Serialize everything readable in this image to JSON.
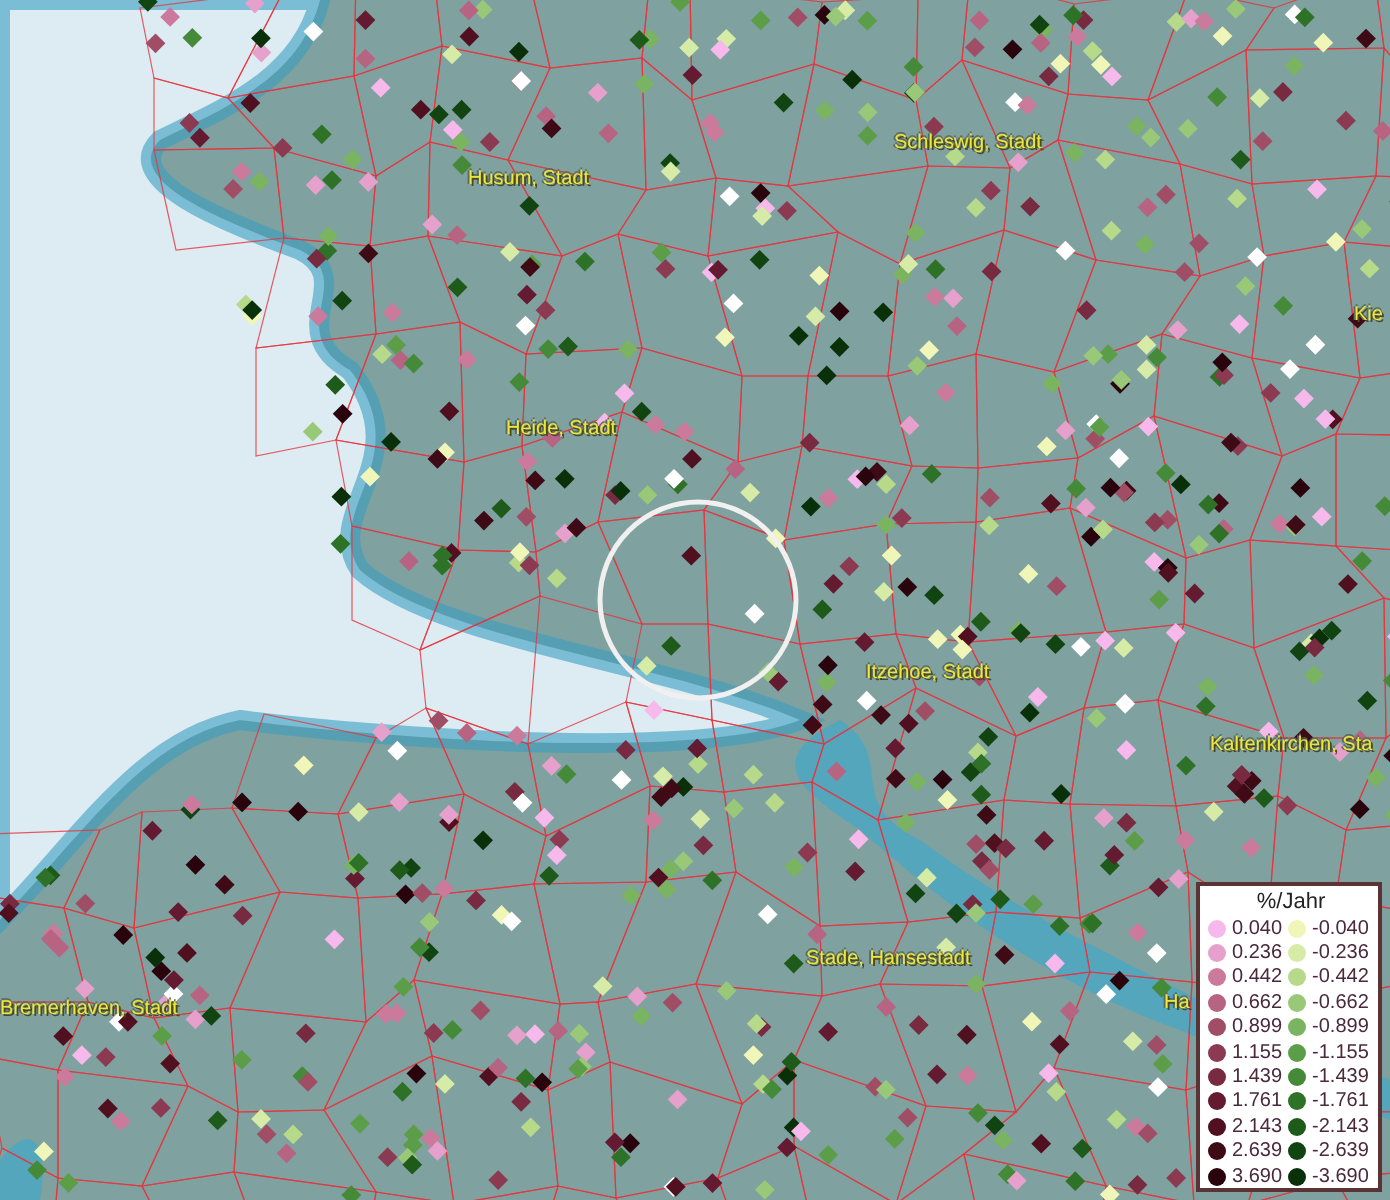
{
  "map": {
    "places": [
      {
        "name": "Husum, Stadt"
      },
      {
        "name": "Schleswig, Stadt"
      },
      {
        "name": "Kie"
      },
      {
        "name": "Heide, Stadt"
      },
      {
        "name": "Itzehoe, Stadt"
      },
      {
        "name": "Kaltenkirchen, Sta"
      },
      {
        "name": "Stade, Hansestadt"
      },
      {
        "name": "Bremerhaven, Stadt"
      },
      {
        "name": "Ha"
      }
    ]
  },
  "legend": {
    "title": "%/Jahr",
    "positive": [
      {
        "value": "0.040",
        "color": "#f7b9ec"
      },
      {
        "value": "0.236",
        "color": "#e6a0cc"
      },
      {
        "value": "0.442",
        "color": "#cc7a9c"
      },
      {
        "value": "0.662",
        "color": "#b66482"
      },
      {
        "value": "0.899",
        "color": "#a04e66"
      },
      {
        "value": "1.155",
        "color": "#8c3a52"
      },
      {
        "value": "1.439",
        "color": "#782a40"
      },
      {
        "value": "1.761",
        "color": "#641a30"
      },
      {
        "value": "2.143",
        "color": "#501020"
      },
      {
        "value": "2.639",
        "color": "#3e0a16"
      },
      {
        "value": "3.690",
        "color": "#2a040c"
      }
    ],
    "negative": [
      {
        "value": "-0.040",
        "color": "#f0f5b8"
      },
      {
        "value": "-0.236",
        "color": "#d6eba6"
      },
      {
        "value": "-0.442",
        "color": "#b6d98a"
      },
      {
        "value": "-0.662",
        "color": "#98c878"
      },
      {
        "value": "-0.899",
        "color": "#7ab460"
      },
      {
        "value": "-1.155",
        "color": "#5c9e48"
      },
      {
        "value": "-1.439",
        "color": "#448a38"
      },
      {
        "value": "-1.761",
        "color": "#2e7228"
      },
      {
        "value": "-2.143",
        "color": "#1e5a1a"
      },
      {
        "value": "-2.639",
        "color": "#124412"
      },
      {
        "value": "-3.690",
        "color": "#0a300a"
      }
    ]
  }
}
